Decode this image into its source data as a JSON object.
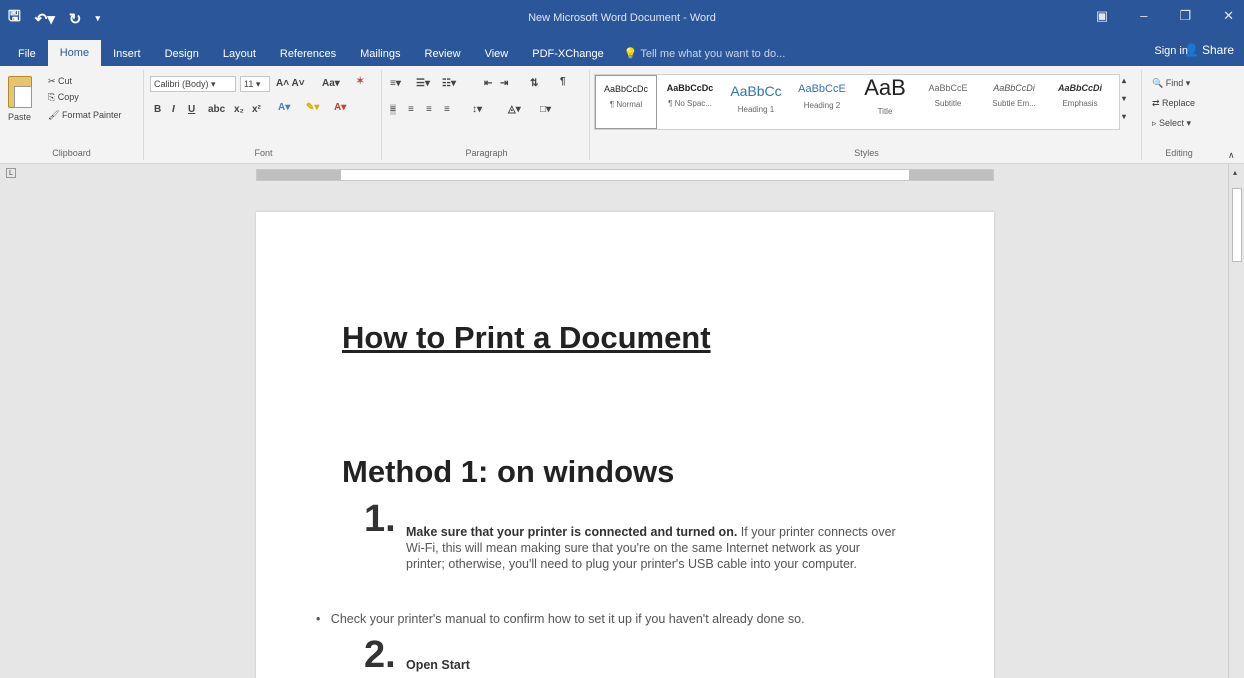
{
  "window": {
    "title": "New Microsoft Word Document - Word",
    "qat": {
      "save_icon": "save-icon",
      "undo_icon": "undo-icon",
      "redo_icon": "redo-icon"
    }
  },
  "tabs": [
    "File",
    "Home",
    "Insert",
    "Design",
    "Layout",
    "References",
    "Mailings",
    "Review",
    "View",
    "PDF-XChange"
  ],
  "active_tab": "Home",
  "tell_me_placeholder": "Tell me what you want to do...",
  "account": {
    "sign_in": "Sign in",
    "share": "Share"
  },
  "ribbon": {
    "clipboard": {
      "paste": "Paste",
      "cut": "Cut",
      "copy": "Copy",
      "format_painter": "Format Painter",
      "label": "Clipboard"
    },
    "font": {
      "font_name": "Calibri (Body)",
      "font_size": "11",
      "label": "Font"
    },
    "paragraph": {
      "label": "Paragraph"
    },
    "styles": {
      "label": "Styles",
      "items": [
        {
          "sample": "AaBbCcDc",
          "name": "¶ Normal"
        },
        {
          "sample": "AaBbCcDc",
          "name": "¶ No Spac..."
        },
        {
          "sample": "AaBbCc",
          "name": "Heading 1"
        },
        {
          "sample": "AaBbCcE",
          "name": "Heading 2"
        },
        {
          "sample": "AaB",
          "name": "Title"
        },
        {
          "sample": "AaBbCcE",
          "name": "Subtitle"
        },
        {
          "sample": "AaBbCcDi",
          "name": "Subtle Em..."
        },
        {
          "sample": "AaBbCcDi",
          "name": "Emphasis"
        }
      ]
    },
    "editing": {
      "find": "Find",
      "replace": "Replace",
      "select": "Select",
      "label": "Editing"
    }
  },
  "document": {
    "title": "How to Print a Document",
    "heading": "Method 1: on windows",
    "step1_number": "1.",
    "step1_bold": "Make sure that your printer is connected and turned on.",
    "step1_text": " If your printer connects over Wi-Fi, this will mean making sure that you're on the same Internet network as your printer; otherwise, you'll need to plug your printer's USB cable into your computer.",
    "bullet": "Check your printer's manual to confirm how to set it up if you haven't already done so.",
    "step2_number": "2.",
    "step2_text": "Open Start"
  }
}
